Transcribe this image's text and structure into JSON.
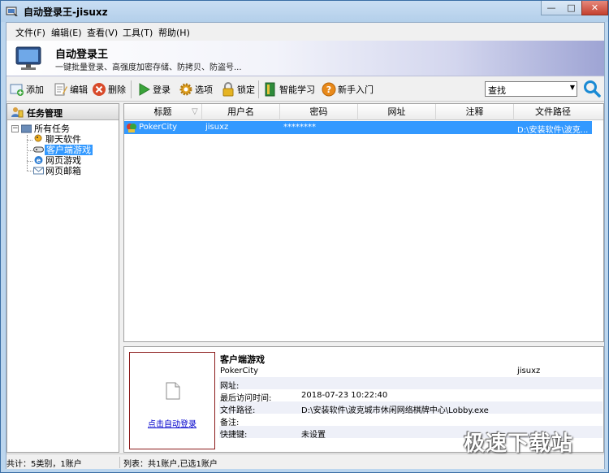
{
  "window": {
    "title": "自动登录王-jisuxz",
    "min_label": "—",
    "max_label": "□",
    "close_label": "✕"
  },
  "menu": {
    "items": [
      "文件(F)",
      "编辑(E)",
      "查看(V)",
      "工具(T)",
      "帮助(H)"
    ]
  },
  "banner": {
    "title": "自动登录王",
    "subtitle": "一键批量登录、高强度加密存储、防拷贝、防盗号..."
  },
  "toolbar": {
    "add": "添加",
    "edit": "编辑",
    "delete": "删除",
    "login": "登录",
    "options": "选项",
    "lock": "锁定",
    "smart_learn": "智能学习",
    "beginner": "新手入门",
    "search_value": "查找"
  },
  "tree": {
    "header": "任务管理",
    "root": "所有任务",
    "children": [
      "聊天软件",
      "客户端游戏",
      "网页游戏",
      "网页邮箱"
    ],
    "selected_index": 1
  },
  "list": {
    "columns": [
      "标题",
      "用户名",
      "密码",
      "网址",
      "注释",
      "文件路径"
    ],
    "rows": [
      {
        "title": "PokerCity",
        "username": "jisuxz",
        "password": "********",
        "url": "",
        "note": "",
        "path": "D:\\安装软件\\波克..."
      }
    ]
  },
  "detail": {
    "preview_link": "点击自动登录",
    "title": "客户端游戏",
    "name": "PokerCity",
    "username": "jisuxz",
    "url_label": "网址:",
    "url_value": "",
    "last_visit_label": "最后访问时间:",
    "last_visit_value": "2018-07-23 10:22:40",
    "path_label": "文件路径:",
    "path_value": "D:\\安装软件\\波克城市休闲网络棋牌中心\\Lobby.exe",
    "note_label": "备注:",
    "note_value": "",
    "hotkey_label": "快捷键:",
    "hotkey_value": "未设置"
  },
  "status": {
    "left": "共计：5类别，1账户",
    "right": "列表：共1账户,已选1账户"
  },
  "watermark": "极速下载站",
  "colors": {
    "selection": "#3399ff",
    "banner_end": "#9ea4d4",
    "link": "#0000cc"
  }
}
